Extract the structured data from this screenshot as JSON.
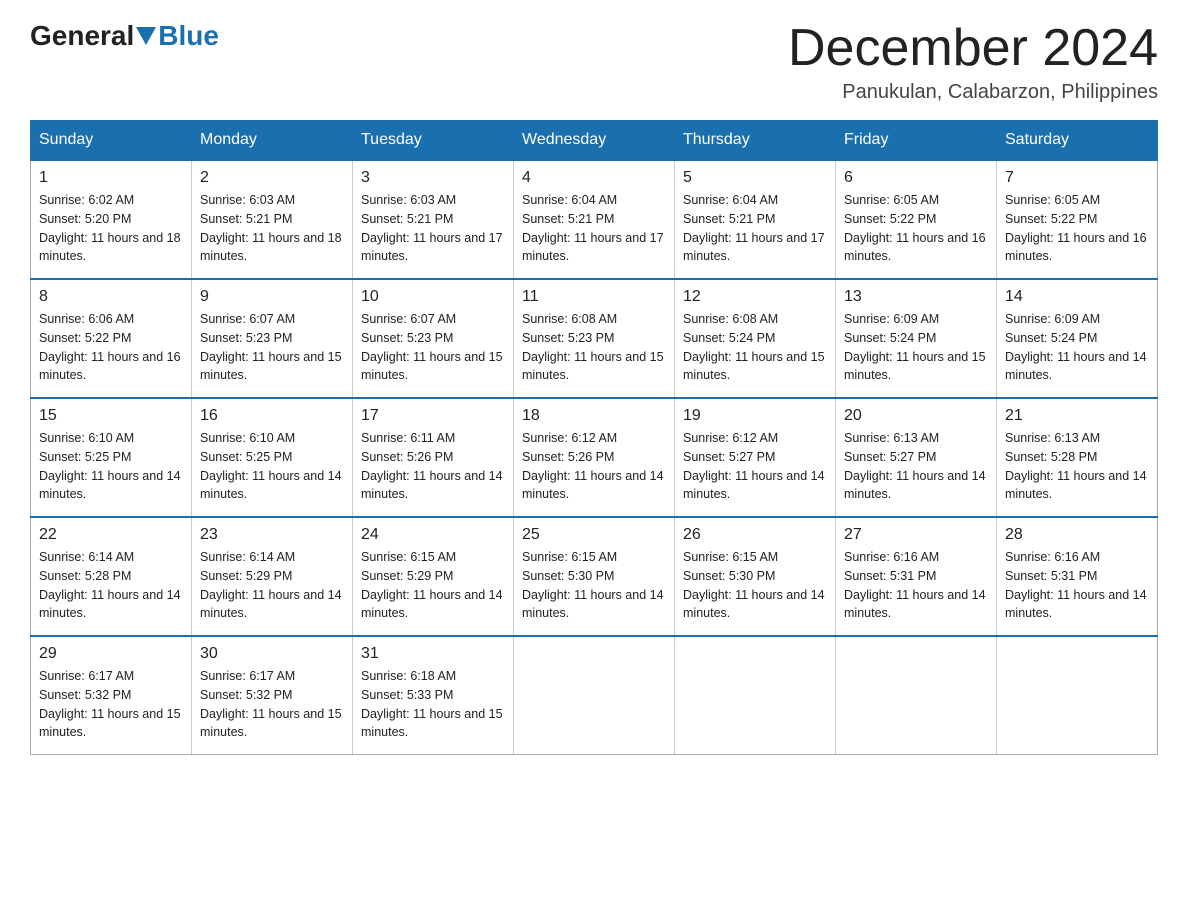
{
  "logo": {
    "general": "General",
    "blue": "Blue"
  },
  "title": "December 2024",
  "subtitle": "Panukulan, Calabarzon, Philippines",
  "days_of_week": [
    "Sunday",
    "Monday",
    "Tuesday",
    "Wednesday",
    "Thursday",
    "Friday",
    "Saturday"
  ],
  "weeks": [
    [
      {
        "day": "1",
        "sunrise": "6:02 AM",
        "sunset": "5:20 PM",
        "daylight": "11 hours and 18 minutes."
      },
      {
        "day": "2",
        "sunrise": "6:03 AM",
        "sunset": "5:21 PM",
        "daylight": "11 hours and 18 minutes."
      },
      {
        "day": "3",
        "sunrise": "6:03 AM",
        "sunset": "5:21 PM",
        "daylight": "11 hours and 17 minutes."
      },
      {
        "day": "4",
        "sunrise": "6:04 AM",
        "sunset": "5:21 PM",
        "daylight": "11 hours and 17 minutes."
      },
      {
        "day": "5",
        "sunrise": "6:04 AM",
        "sunset": "5:21 PM",
        "daylight": "11 hours and 17 minutes."
      },
      {
        "day": "6",
        "sunrise": "6:05 AM",
        "sunset": "5:22 PM",
        "daylight": "11 hours and 16 minutes."
      },
      {
        "day": "7",
        "sunrise": "6:05 AM",
        "sunset": "5:22 PM",
        "daylight": "11 hours and 16 minutes."
      }
    ],
    [
      {
        "day": "8",
        "sunrise": "6:06 AM",
        "sunset": "5:22 PM",
        "daylight": "11 hours and 16 minutes."
      },
      {
        "day": "9",
        "sunrise": "6:07 AM",
        "sunset": "5:23 PM",
        "daylight": "11 hours and 15 minutes."
      },
      {
        "day": "10",
        "sunrise": "6:07 AM",
        "sunset": "5:23 PM",
        "daylight": "11 hours and 15 minutes."
      },
      {
        "day": "11",
        "sunrise": "6:08 AM",
        "sunset": "5:23 PM",
        "daylight": "11 hours and 15 minutes."
      },
      {
        "day": "12",
        "sunrise": "6:08 AM",
        "sunset": "5:24 PM",
        "daylight": "11 hours and 15 minutes."
      },
      {
        "day": "13",
        "sunrise": "6:09 AM",
        "sunset": "5:24 PM",
        "daylight": "11 hours and 15 minutes."
      },
      {
        "day": "14",
        "sunrise": "6:09 AM",
        "sunset": "5:24 PM",
        "daylight": "11 hours and 14 minutes."
      }
    ],
    [
      {
        "day": "15",
        "sunrise": "6:10 AM",
        "sunset": "5:25 PM",
        "daylight": "11 hours and 14 minutes."
      },
      {
        "day": "16",
        "sunrise": "6:10 AM",
        "sunset": "5:25 PM",
        "daylight": "11 hours and 14 minutes."
      },
      {
        "day": "17",
        "sunrise": "6:11 AM",
        "sunset": "5:26 PM",
        "daylight": "11 hours and 14 minutes."
      },
      {
        "day": "18",
        "sunrise": "6:12 AM",
        "sunset": "5:26 PM",
        "daylight": "11 hours and 14 minutes."
      },
      {
        "day": "19",
        "sunrise": "6:12 AM",
        "sunset": "5:27 PM",
        "daylight": "11 hours and 14 minutes."
      },
      {
        "day": "20",
        "sunrise": "6:13 AM",
        "sunset": "5:27 PM",
        "daylight": "11 hours and 14 minutes."
      },
      {
        "day": "21",
        "sunrise": "6:13 AM",
        "sunset": "5:28 PM",
        "daylight": "11 hours and 14 minutes."
      }
    ],
    [
      {
        "day": "22",
        "sunrise": "6:14 AM",
        "sunset": "5:28 PM",
        "daylight": "11 hours and 14 minutes."
      },
      {
        "day": "23",
        "sunrise": "6:14 AM",
        "sunset": "5:29 PM",
        "daylight": "11 hours and 14 minutes."
      },
      {
        "day": "24",
        "sunrise": "6:15 AM",
        "sunset": "5:29 PM",
        "daylight": "11 hours and 14 minutes."
      },
      {
        "day": "25",
        "sunrise": "6:15 AM",
        "sunset": "5:30 PM",
        "daylight": "11 hours and 14 minutes."
      },
      {
        "day": "26",
        "sunrise": "6:15 AM",
        "sunset": "5:30 PM",
        "daylight": "11 hours and 14 minutes."
      },
      {
        "day": "27",
        "sunrise": "6:16 AM",
        "sunset": "5:31 PM",
        "daylight": "11 hours and 14 minutes."
      },
      {
        "day": "28",
        "sunrise": "6:16 AM",
        "sunset": "5:31 PM",
        "daylight": "11 hours and 14 minutes."
      }
    ],
    [
      {
        "day": "29",
        "sunrise": "6:17 AM",
        "sunset": "5:32 PM",
        "daylight": "11 hours and 15 minutes."
      },
      {
        "day": "30",
        "sunrise": "6:17 AM",
        "sunset": "5:32 PM",
        "daylight": "11 hours and 15 minutes."
      },
      {
        "day": "31",
        "sunrise": "6:18 AM",
        "sunset": "5:33 PM",
        "daylight": "11 hours and 15 minutes."
      },
      null,
      null,
      null,
      null
    ]
  ]
}
